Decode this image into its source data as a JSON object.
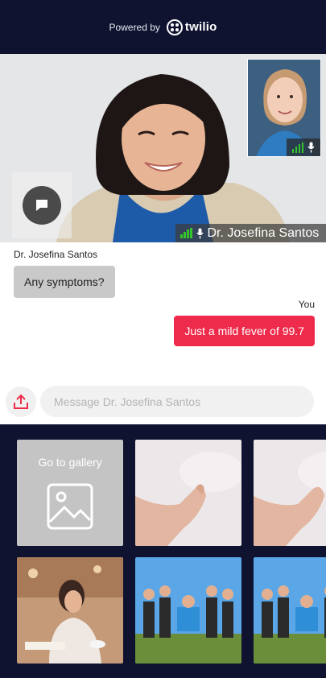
{
  "header": {
    "powered_by": "Powered by",
    "logo_text": "twilio"
  },
  "call": {
    "remote_name": "Dr. Josefina Santos",
    "signal_color": "#35c42b"
  },
  "chat": {
    "sender_name": "Dr. Josefina Santos",
    "incoming_message": "Any symptoms?",
    "you_label": "You",
    "outgoing_message": "Just a mild fever of 99.7",
    "input_value": "",
    "input_placeholder": "Message Dr. Josefina Santos"
  },
  "gallery": {
    "goto_label": "Go to gallery",
    "items": [
      "feet-on-water-photo",
      "feet-on-water-photo",
      "woman-studying-photo",
      "group-of-friends-photo",
      "group-of-friends-photo"
    ]
  },
  "colors": {
    "header_bg": "#0f1330",
    "accent": "#ef2b4b",
    "incoming_bubble": "#c9c9c9"
  }
}
